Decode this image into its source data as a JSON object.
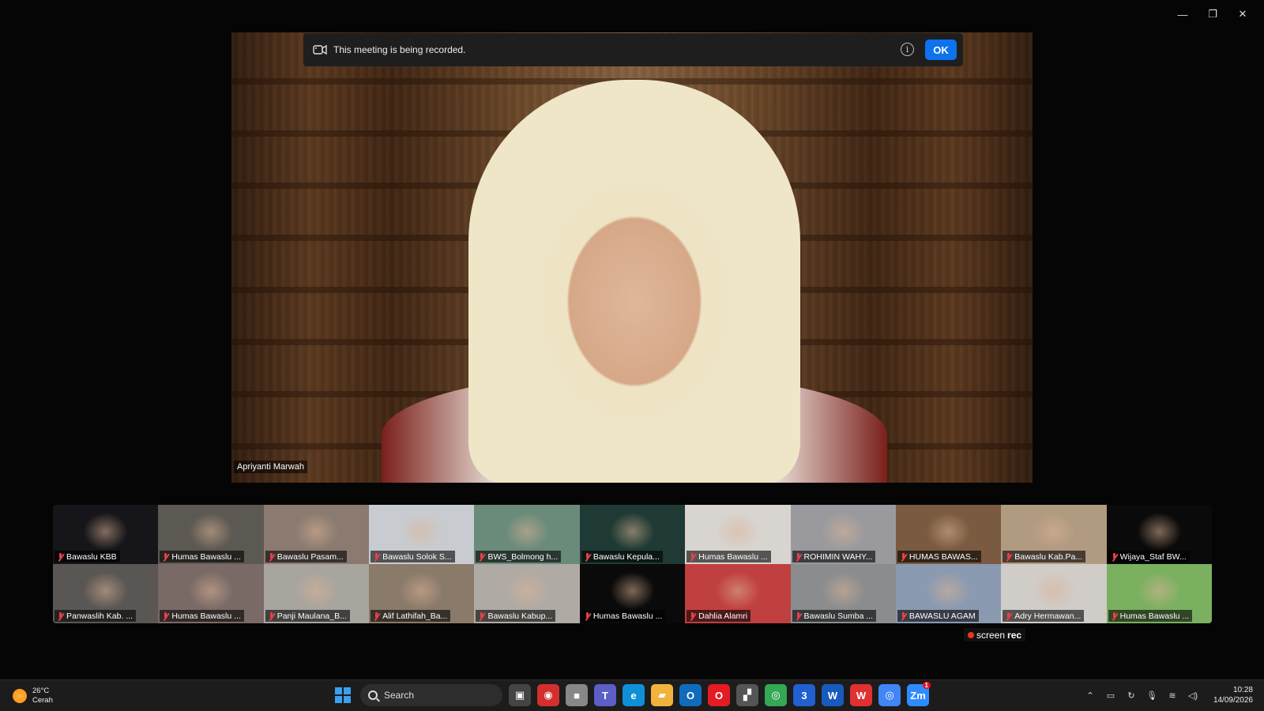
{
  "window": {
    "minimize": "—",
    "restore": "❐",
    "close": "✕"
  },
  "main_video": {
    "speaker_name": "Apriyanti Marwah",
    "banner": {
      "text": "This meeting is being recorded.",
      "info": "i",
      "ok": "OK"
    }
  },
  "gallery": {
    "tiles": [
      {
        "name": "Bawaslu KBB",
        "bg": "#15151a"
      },
      {
        "name": "Humas Bawaslu ...",
        "bg": "#5c5852"
      },
      {
        "name": "Bawaslu Pasam...",
        "bg": "#8a7a70"
      },
      {
        "name": "Bawaslu Solok S...",
        "bg": "#c8ccd0"
      },
      {
        "name": "BWS_Bolmong h...",
        "bg": "#6a8a7a"
      },
      {
        "name": "Bawaslu Kepula...",
        "bg": "#1f3a34"
      },
      {
        "name": "Humas Bawaslu ...",
        "bg": "#d8d4d0"
      },
      {
        "name": "ROHIMIN WAHY...",
        "bg": "#9a9a9e"
      },
      {
        "name": "HUMAS BAWAS...",
        "bg": "#7a5a40"
      },
      {
        "name": "Bawaslu Kab.Pa...",
        "bg": "#b09a80"
      },
      {
        "name": "Wijaya_Staf BW...",
        "bg": "#0a0a0a"
      },
      {
        "name": "Panwaslih Kab. ...",
        "bg": "#5a5654"
      },
      {
        "name": "Humas Bawaslu ...",
        "bg": "#7a6a66"
      },
      {
        "name": "Panji Maulana_B...",
        "bg": "#a8a49e"
      },
      {
        "name": "Alif Lathifah_Ba...",
        "bg": "#8a7a6a"
      },
      {
        "name": "Bawaslu Kabup...",
        "bg": "#b0aaa4"
      },
      {
        "name": "Humas Bawaslu ...",
        "bg": "#0a0a0a"
      },
      {
        "name": "Dahlia Alamri",
        "bg": "#c04040"
      },
      {
        "name": "Bawaslu Sumba ...",
        "bg": "#8a8c8e"
      },
      {
        "name": "BAWASLU AGAM",
        "bg": "#8a9ab0"
      },
      {
        "name": "Adry Hermawan...",
        "bg": "#d0ccc8"
      },
      {
        "name": "Humas Bawaslu ...",
        "bg": "#7ab060"
      }
    ]
  },
  "screenrec": {
    "label_a": "screen",
    "label_b": "rec"
  },
  "taskbar": {
    "weather": {
      "temp": "26°C",
      "cond": "Cerah"
    },
    "search": {
      "label": "Search"
    },
    "apps": [
      {
        "name": "task-view-icon",
        "glyph": "▣",
        "color": "#444"
      },
      {
        "name": "app-red-icon",
        "glyph": "◉",
        "color": "#d32f2f"
      },
      {
        "name": "app-gray-icon",
        "glyph": "■",
        "color": "#888"
      },
      {
        "name": "teams-icon",
        "glyph": "T",
        "color": "#5b5fc7"
      },
      {
        "name": "edge-icon",
        "glyph": "e",
        "color": "#0f8fd8"
      },
      {
        "name": "file-explorer-icon",
        "glyph": "▰",
        "color": "#f2b33d"
      },
      {
        "name": "outlook-icon",
        "glyph": "O",
        "color": "#0f6cbd"
      },
      {
        "name": "opera-icon",
        "glyph": "O",
        "color": "#e41b23"
      },
      {
        "name": "clapper-icon",
        "glyph": "▞",
        "color": "#555"
      },
      {
        "name": "chrome-icon",
        "glyph": "◎",
        "color": "#34a853"
      },
      {
        "name": "app-three-icon",
        "glyph": "3",
        "color": "#2060d0"
      },
      {
        "name": "word-icon",
        "glyph": "W",
        "color": "#185abd"
      },
      {
        "name": "wps-icon",
        "glyph": "W",
        "color": "#e03030"
      },
      {
        "name": "chrome-2-icon",
        "glyph": "◎",
        "color": "#4285f4"
      },
      {
        "name": "zoom-icon",
        "glyph": "Zm",
        "color": "#2d8cff",
        "badge": "1"
      }
    ],
    "clock": {
      "time": "10:28",
      "date": "14/09/2026"
    }
  }
}
